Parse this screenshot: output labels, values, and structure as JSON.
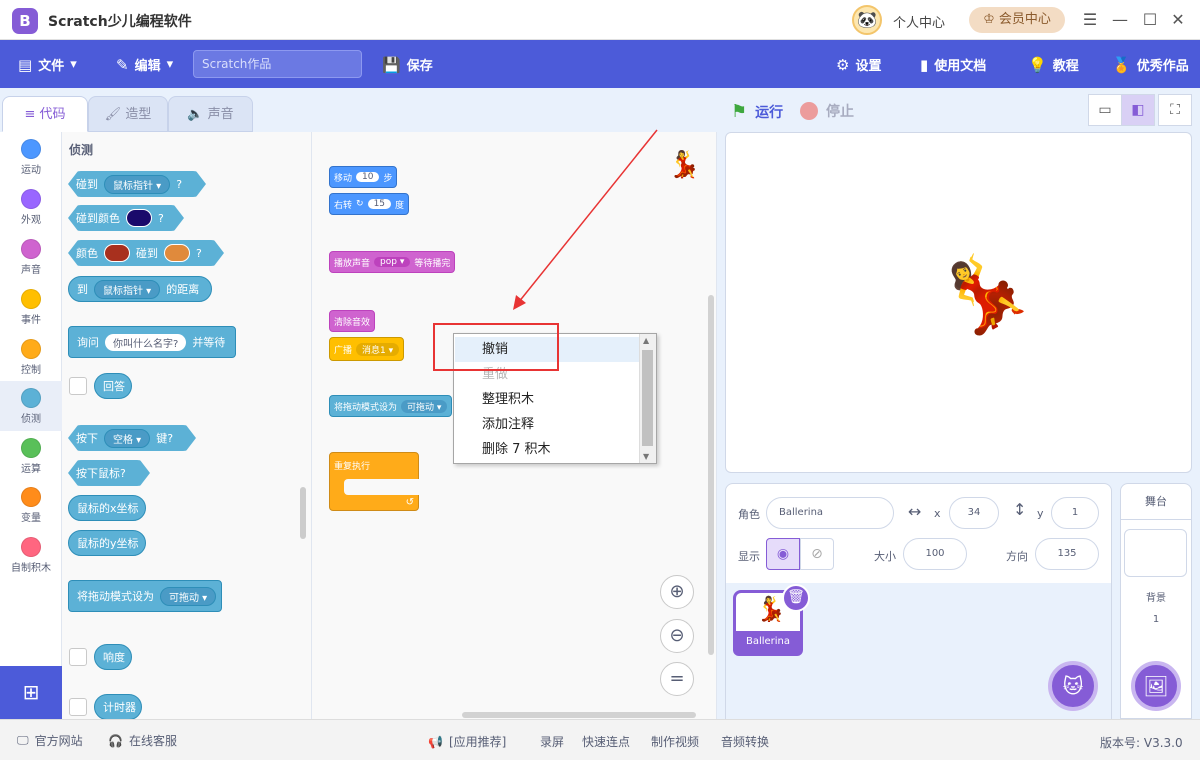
{
  "titlebar": {
    "app_title": "Scratch少儿编程软件",
    "logo_letter": "B",
    "personal_center": "个人中心",
    "vip_center": "会员中心",
    "icons": [
      "minimize-icon",
      "maximize-icon",
      "close-icon",
      "hamburger-icon"
    ]
  },
  "menubar": {
    "file": "文件",
    "edit": "编辑",
    "project_placeholder": "Scratch作品",
    "save": "保存",
    "settings": "设置",
    "docs": "使用文档",
    "tutorial": "教程",
    "featured": "优秀作品",
    "color": "#4c5bd9"
  },
  "tabs": [
    {
      "label": "代码",
      "active": true
    },
    {
      "label": "造型",
      "active": false
    },
    {
      "label": "声音",
      "active": false
    }
  ],
  "categories": [
    {
      "label": "运动",
      "color": "#4c97ff"
    },
    {
      "label": "外观",
      "color": "#9966ff"
    },
    {
      "label": "声音",
      "color": "#cf63cf"
    },
    {
      "label": "事件",
      "color": "#ffbf00"
    },
    {
      "label": "控制",
      "color": "#ffab19"
    },
    {
      "label": "侦测",
      "color": "#5cb1d6",
      "active": true
    },
    {
      "label": "运算",
      "color": "#59c059"
    },
    {
      "label": "变量",
      "color": "#ff8c1a"
    },
    {
      "label": "自制积木",
      "color": "#ff6680"
    }
  ],
  "palette": {
    "section_title": "侦测",
    "touching": {
      "prefix": "碰到",
      "option": "鼠标指针",
      "suffix": "?"
    },
    "touching_color": {
      "prefix": "碰到颜色",
      "suffix": "?",
      "swatch": "#1a0a6b"
    },
    "color_touching": {
      "prefix": "颜色",
      "mid": "碰到",
      "suffix": "?",
      "swatch1": "#a8301e",
      "swatch2": "#e08a3c"
    },
    "distance": {
      "prefix": "到",
      "option": "鼠标指针",
      "suffix": "的距离"
    },
    "ask": {
      "prefix": "询问",
      "value": "你叫什么名字?",
      "suffix": "并等待"
    },
    "answer": "回答",
    "key_pressed": {
      "prefix": "按下",
      "option": "空格",
      "suffix": "键?"
    },
    "mouse_down": "按下鼠标?",
    "mouse_x": "鼠标的x坐标",
    "mouse_y": "鼠标的y坐标",
    "drag_mode": {
      "prefix": "将拖动模式设为",
      "option": "可拖动"
    },
    "loudness": "响度",
    "timer": "计时器"
  },
  "code": {
    "move": {
      "prefix": "移动",
      "value": "10",
      "suffix": "步"
    },
    "turn": {
      "prefix": "右转",
      "value": "15",
      "suffix": "度"
    },
    "play_sound": {
      "prefix": "播放声音",
      "option": "pop",
      "suffix": "等待播完"
    },
    "clear_effects": "清除音效",
    "broadcast": {
      "prefix": "广播",
      "option": "消息1"
    },
    "drag_mode": {
      "prefix": "将拖动模式设为",
      "option": "可拖动"
    },
    "forever": "重复执行"
  },
  "context_menu": {
    "items": [
      {
        "label": "撤销",
        "highlighted": true,
        "disabled": false
      },
      {
        "label": "重做",
        "highlighted": false,
        "disabled": true
      },
      {
        "label": "整理积木",
        "highlighted": false,
        "disabled": false
      },
      {
        "label": "添加注释",
        "highlighted": false,
        "disabled": false
      },
      {
        "label": "删除 7 积木",
        "highlighted": false,
        "disabled": false
      }
    ]
  },
  "stage_controls": {
    "run": "运行",
    "stop": "停止"
  },
  "sprite_info": {
    "sprite_label": "角色",
    "sprite_name": "Ballerina",
    "x_label": "x",
    "x_value": "34",
    "y_label": "y",
    "y_value": "1",
    "show_label": "显示",
    "size_label": "大小",
    "size_value": "100",
    "direction_label": "方向",
    "direction_value": "135"
  },
  "sprites": [
    {
      "name": "Ballerina",
      "selected": true
    }
  ],
  "stage_panel": {
    "title": "舞台",
    "backdrop_label": "背景",
    "backdrop_count": "1"
  },
  "statusbar": {
    "website": "官方网站",
    "support": "在线客服",
    "recommend": "[应用推荐]",
    "links": [
      "录屏",
      "快速连点",
      "制作视频",
      "音频转换"
    ],
    "version": "版本号: V3.3.0"
  }
}
